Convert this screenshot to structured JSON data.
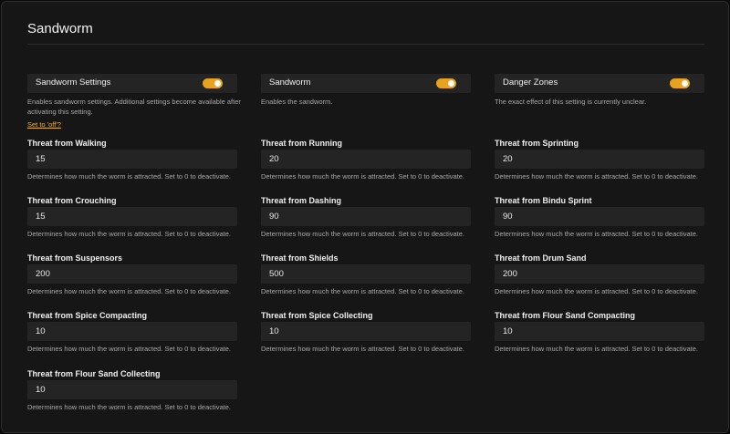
{
  "page": {
    "title": "Sandworm"
  },
  "toggles": [
    {
      "label": "Sandworm Settings",
      "on": true,
      "description": "Enables sandworm settings. Additional settings become available after activating this setting."
    },
    {
      "label": "Sandworm",
      "on": true,
      "description": "Enables the sandworm."
    },
    {
      "label": "Danger Zones",
      "on": true,
      "description": "The exact effect of this setting is currently unclear."
    }
  ],
  "reset_link": "Set to 'off'?",
  "help_text": "Determines how much the worm is attracted. Set to 0 to deactivate.",
  "fields": [
    {
      "label": "Threat from Walking",
      "value": "15"
    },
    {
      "label": "Threat from Running",
      "value": "20"
    },
    {
      "label": "Threat from Sprinting",
      "value": "20"
    },
    {
      "label": "Threat from Crouching",
      "value": "15"
    },
    {
      "label": "Threat from Dashing",
      "value": "90"
    },
    {
      "label": "Threat from Bindu Sprint",
      "value": "90"
    },
    {
      "label": "Threat from Suspensors",
      "value": "200"
    },
    {
      "label": "Threat from Shields",
      "value": "500"
    },
    {
      "label": "Threat from Drum Sand",
      "value": "200"
    },
    {
      "label": "Threat from Spice Compacting",
      "value": "10"
    },
    {
      "label": "Threat from Spice Collecting",
      "value": "10"
    },
    {
      "label": "Threat from Flour Sand Compacting",
      "value": "10"
    },
    {
      "label": "Threat from Flour Sand Collecting",
      "value": "10"
    }
  ],
  "colors": {
    "accent": "#e8a21f",
    "link": "#e8b33a",
    "background": "#161616",
    "input_bg": "#242424"
  }
}
